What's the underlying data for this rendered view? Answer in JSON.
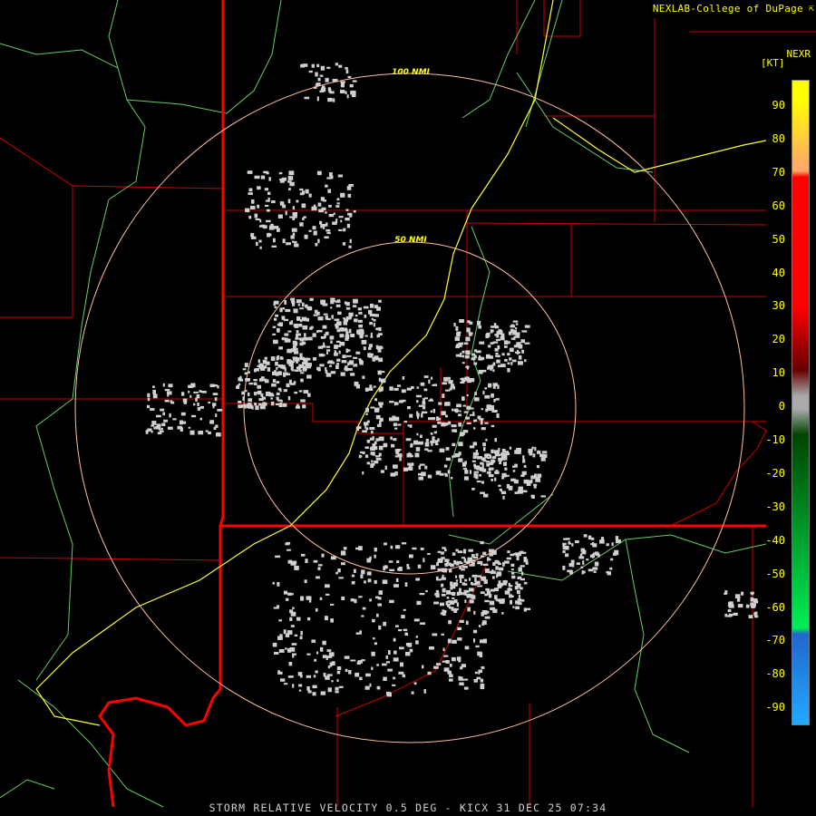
{
  "header": {
    "credit": "NEXLAB-College of DuPage",
    "credit_icon": "cursor-arrow-icon",
    "product": "NEXR",
    "unit": "[KT]"
  },
  "legend": {
    "ticks": [
      "90",
      "80",
      "70",
      "60",
      "50",
      "40",
      "30",
      "20",
      "10",
      "0",
      "-10",
      "-20",
      "-30",
      "-40",
      "-50",
      "-60",
      "-70",
      "-80",
      "-90"
    ],
    "colors": {
      "inbound_light": "#ffff00",
      "inbound_orange": "#ffaa66",
      "inbound_red": "#ff0000",
      "inbound_dark": "#660000",
      "near_zero": "#aaaaaa",
      "outbound_dark": "#004400",
      "outbound_green": "#00ee55",
      "outbound_blue": "#2266cc",
      "outbound_light": "#22aaff"
    }
  },
  "rings": {
    "inner_label": "50 NMI",
    "outer_label": "100 NMI",
    "color": "#ffbfa0"
  },
  "map_colors": {
    "state_border": "#ff0000",
    "county_border": "#cc0000",
    "river": "#66cc66",
    "highway": "#ffff33",
    "echo": "#d0d0d0"
  },
  "footer": {
    "caption": "STORM RELATIVE VELOCITY 0.5 DEG - KICX 31 DEC 25 07:34"
  }
}
